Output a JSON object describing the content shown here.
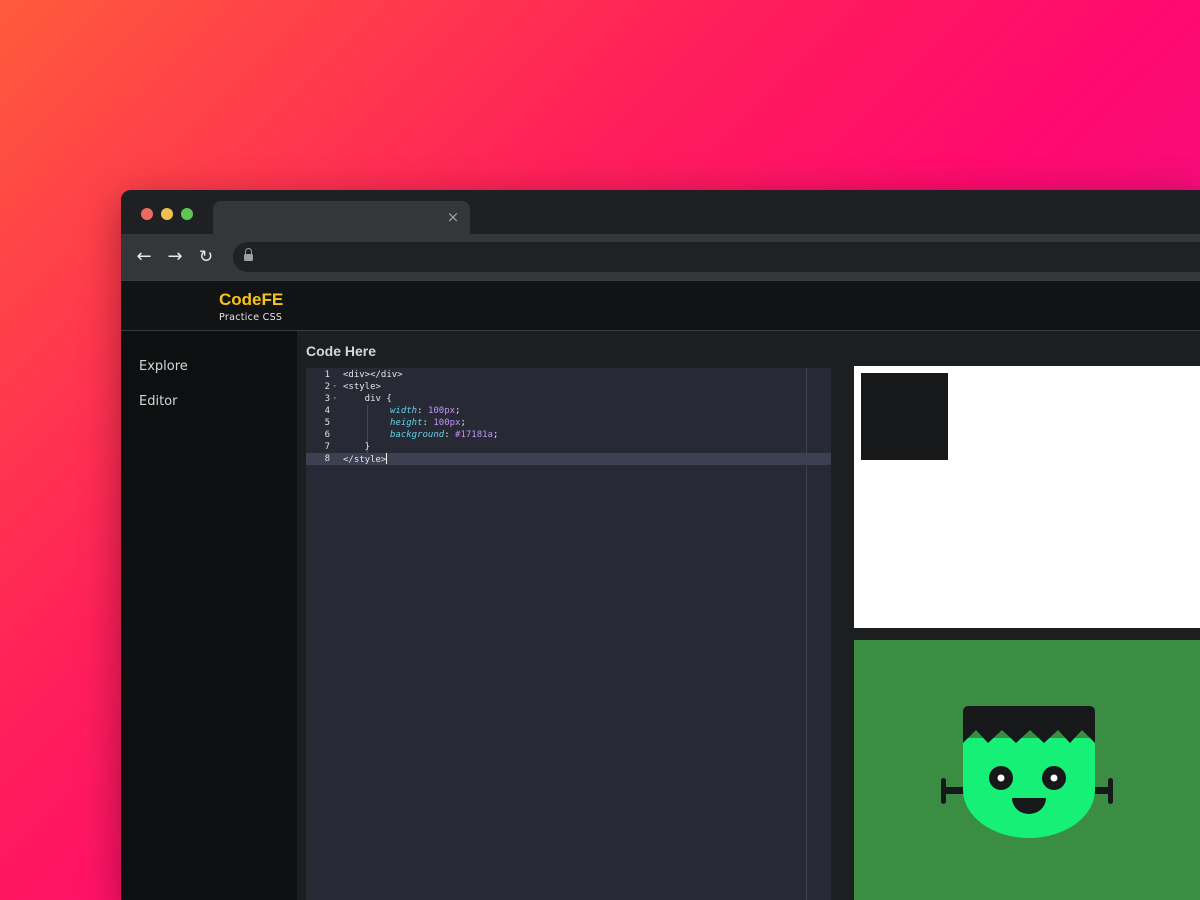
{
  "browser": {
    "tab_close_glyph": "×",
    "nav": {
      "back_glyph": "←",
      "forward_glyph": "→",
      "reload_glyph": "↻"
    },
    "address_icon": "lock-icon"
  },
  "app": {
    "brand": "CodeFE",
    "tagline": "Practice CSS",
    "colors": {
      "brand": "#f5c518",
      "target_background": "#3a8d42",
      "monster_face": "#17f076",
      "monster_hair": "#17181a"
    }
  },
  "sidebar": {
    "items": [
      {
        "label": "Explore"
      },
      {
        "label": "Editor"
      }
    ]
  },
  "editor": {
    "heading": "Code Here",
    "line_numbers": [
      "1",
      "2",
      "3",
      "4",
      "5",
      "6",
      "7",
      "8"
    ],
    "lines": [
      {
        "text": "<div></div>"
      },
      {
        "text": "<style>"
      },
      {
        "text": "    div {"
      },
      {
        "prop": "width",
        "sep": ": ",
        "value": "100px",
        "end": ";"
      },
      {
        "prop": "height",
        "sep": ": ",
        "value": "100px",
        "end": ";"
      },
      {
        "prop": "background",
        "sep": ": ",
        "value": "#17181a",
        "end": ";"
      },
      {
        "text": "    }"
      },
      {
        "text": "</style>"
      }
    ],
    "active_line": 8
  },
  "preview": {
    "box_color": "#17181a"
  }
}
